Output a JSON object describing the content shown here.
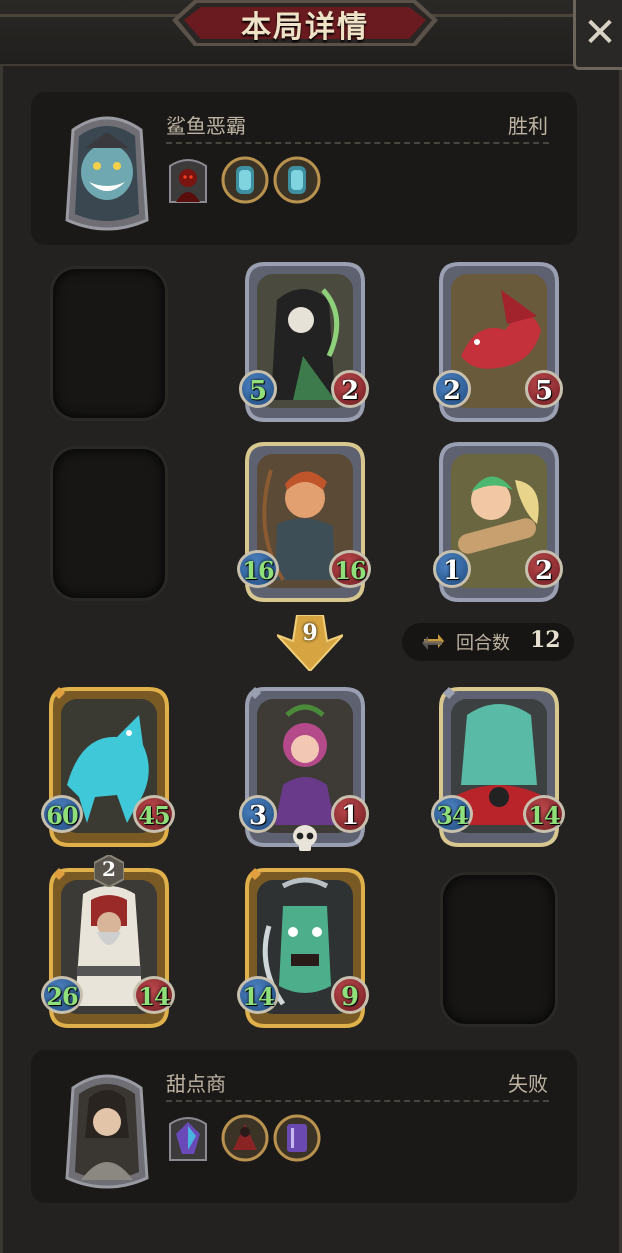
{
  "header": {
    "title": "本局详情",
    "close_label": "✕"
  },
  "top_player": {
    "name": "鲨鱼恶霸",
    "result": "胜利",
    "avatar_icon": "shark-bully-portrait-icon",
    "relics": [
      "dark-figure-relic-icon",
      "blue-potion-relic-icon",
      "blue-potion-relic-icon"
    ]
  },
  "bottom_player": {
    "name": "甜点商",
    "result": "失败",
    "avatar_icon": "dessert-merchant-portrait-icon",
    "relics": [
      "purple-crystal-relic-icon",
      "red-cloak-relic-icon",
      "purple-book-relic-icon"
    ]
  },
  "round": {
    "label": "回合数",
    "value": "12"
  },
  "turn_marker": "9",
  "colors": {
    "silver_frame": "#8a8fa0",
    "gold_frame": "#c99a3a",
    "attack": "#2f6aa8",
    "health": "#a3303a",
    "buffed_stat": "#8fe07a"
  },
  "enemy_units": [
    {
      "icon": "grim-reaper-icon",
      "attack": "5",
      "health": "2",
      "tier": "silver",
      "attack_buffed": true,
      "health_buffed": false
    },
    {
      "icon": "red-dragon-icon",
      "attack": "2",
      "health": "5",
      "tier": "silver",
      "attack_buffed": false,
      "health_buffed": false
    },
    {
      "icon": "elf-archer-icon",
      "attack": "16",
      "health": "16",
      "tier": "silver",
      "attack_buffed": true,
      "health_buffed": true
    },
    {
      "icon": "fairy-icon",
      "attack": "1",
      "health": "2",
      "tier": "silver",
      "attack_buffed": false,
      "health_buffed": false
    }
  ],
  "ally_units": [
    {
      "icon": "spirit-wolf-icon",
      "attack": "60",
      "health": "45",
      "tier": "gold",
      "attack_buffed": true,
      "health_buffed": true
    },
    {
      "icon": "flower-witch-icon",
      "attack": "3",
      "health": "1",
      "tier": "silver",
      "attack_buffed": false,
      "health_buffed": false
    },
    {
      "icon": "ghost-ogre-icon",
      "attack": "34",
      "health": "14",
      "tier": "silver",
      "attack_buffed": true,
      "health_buffed": true
    },
    {
      "icon": "hooded-sage-icon",
      "attack": "26",
      "health": "14",
      "tier": "gold",
      "attack_buffed": true,
      "health_buffed": true,
      "level": "2"
    },
    {
      "icon": "forest-totem-icon",
      "attack": "14",
      "health": "9",
      "tier": "gold",
      "attack_buffed": true,
      "health_buffed": true
    }
  ]
}
